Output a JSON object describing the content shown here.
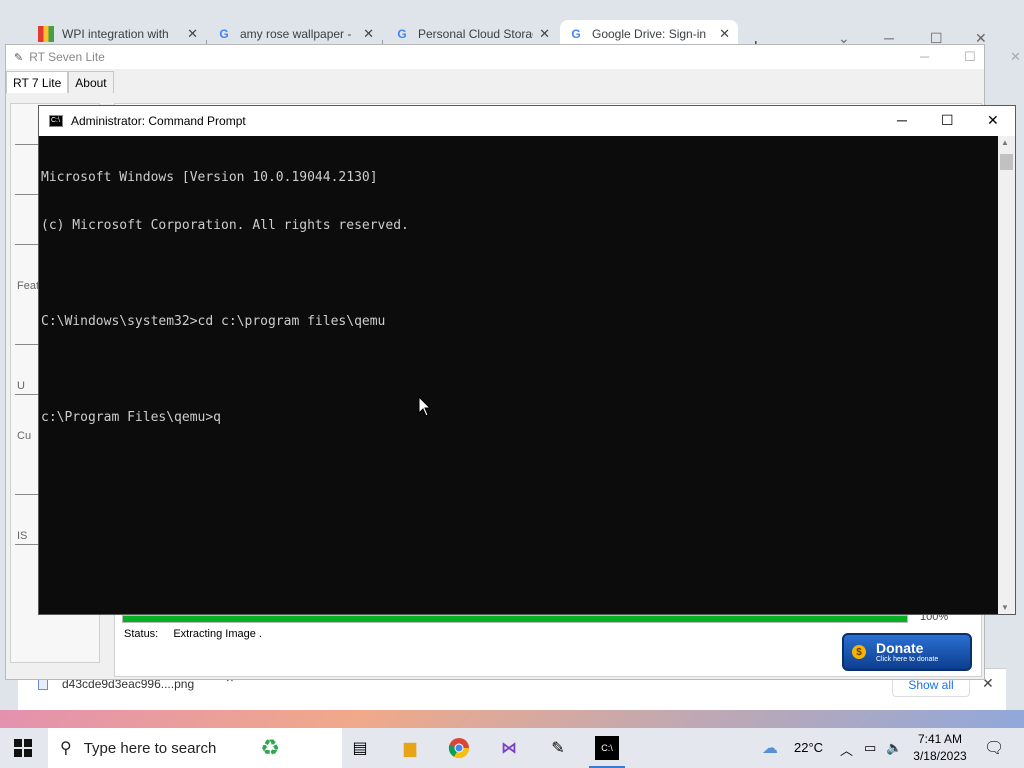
{
  "browser": {
    "tabs": [
      {
        "label": "WPI integration with",
        "favicon": "wpi-favicon"
      },
      {
        "label": "amy rose wallpaper -",
        "favicon": "google-favicon"
      },
      {
        "label": "Personal Cloud Storag",
        "favicon": "google-favicon"
      },
      {
        "label": "Google Drive: Sign-in",
        "favicon": "google-favicon",
        "active": true
      }
    ],
    "new_tab": "+",
    "download": {
      "filename": "d43cde9d3eac996....png",
      "show_all": "Show all"
    }
  },
  "rt": {
    "title": "RT Seven Lite",
    "tabs": [
      "RT 7 Lite",
      "About"
    ],
    "sidebar": [
      "Feat",
      "U",
      "Cu",
      "IS"
    ],
    "progress_percent": 100,
    "progress_label": "100%",
    "status_label": "Status:",
    "status_value": "Extracting Image .",
    "donate": {
      "title": "Donate",
      "subtitle": "Click here to donate"
    }
  },
  "cmd": {
    "title": "Administrator:  Command Prompt",
    "lines": [
      "Microsoft Windows [Version 10.0.19044.2130]",
      "(c) Microsoft Corporation. All rights reserved.",
      "",
      "C:\\Windows\\system32>cd c:\\program files\\qemu",
      "",
      "c:\\Program Files\\qemu>q"
    ]
  },
  "taskbar": {
    "search_placeholder": "Type here to search",
    "weather": "22°C",
    "time": "7:41 AM",
    "date": "3/18/2023",
    "pinned": [
      "task-view-icon",
      "file-explorer-icon",
      "chrome-icon",
      "visual-studio-icon",
      "rt7lite-icon",
      "command-prompt-icon"
    ]
  },
  "colors": {
    "progress_fill": "#06b025",
    "cmd_background": "#0c0c0c",
    "cmd_text": "#cccccc",
    "donate_blue": "#2a6fd1"
  }
}
